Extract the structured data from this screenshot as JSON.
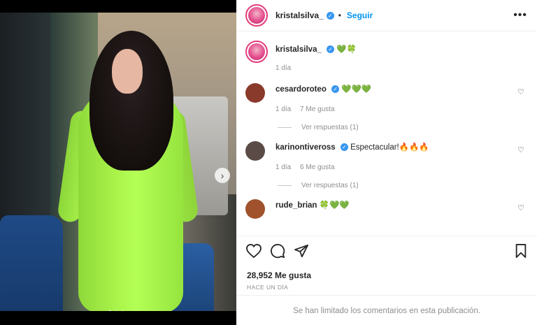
{
  "post": {
    "username": "kristalsilva_",
    "follow_label": "Seguir",
    "separator": "•",
    "more_label": "•••",
    "next_icon": "chevron-right-icon",
    "dots_count": 3
  },
  "caption": {
    "username": "kristalsilva_",
    "text": "💚🍀",
    "time": "1 día"
  },
  "comments": [
    {
      "username": "cesardoroteo",
      "text": "💚💚💚",
      "time": "1 día",
      "likes": "7 Me gusta",
      "replies": "Ver respuestas (1)",
      "avatar_color": "#8a3a2a"
    },
    {
      "username": "karinontiveross",
      "text": "Espectacular!🔥🔥🔥",
      "time": "1 día",
      "likes": "6 Me gusta",
      "replies": "Ver respuestas (1)",
      "avatar_color": "#5a4b46"
    },
    {
      "username": "rude_brian",
      "text": "🍀💚💚",
      "avatar_color": "#a0522d"
    }
  ],
  "actions": {
    "likes": "28,952 Me gusta",
    "ago": "HACE UN DÍA",
    "limited": "Se han limitado los comentarios en esta publicación."
  },
  "colors": {
    "accent": "#0095f6",
    "verified": "#3897f0",
    "ring": "#e23c7a"
  }
}
